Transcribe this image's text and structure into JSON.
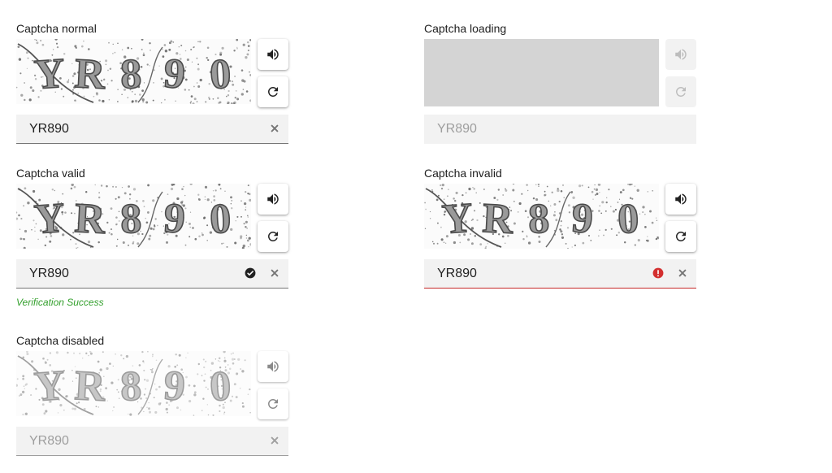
{
  "captchas": {
    "normal": {
      "label": "Captcha normal",
      "image_text": "YR890",
      "value": "YR890",
      "state": "normal"
    },
    "loading": {
      "label": "Captcha loading",
      "value": "YR890",
      "state": "loading"
    },
    "valid": {
      "label": "Captcha valid",
      "image_text": "YR890",
      "value": "YR890",
      "state": "valid",
      "helper": "Verification Success"
    },
    "invalid": {
      "label": "Captcha invalid",
      "image_text": "YR890",
      "value": "YR890",
      "state": "invalid"
    },
    "disabled": {
      "label": "Captcha disabled",
      "image_text": "YR890",
      "value": "YR890",
      "state": "disabled"
    }
  },
  "icons": {
    "audio": "speaker-icon",
    "refresh": "refresh-icon",
    "clear": "close-icon",
    "valid": "check-circle-icon",
    "invalid": "error-circle-icon"
  },
  "colors": {
    "icon": "#212121",
    "icon_disabled": "#bdbdbd",
    "valid": "#212121",
    "invalid": "#d32f2f",
    "helper_success": "#33a02c",
    "input_bg": "#f2f2f2"
  }
}
